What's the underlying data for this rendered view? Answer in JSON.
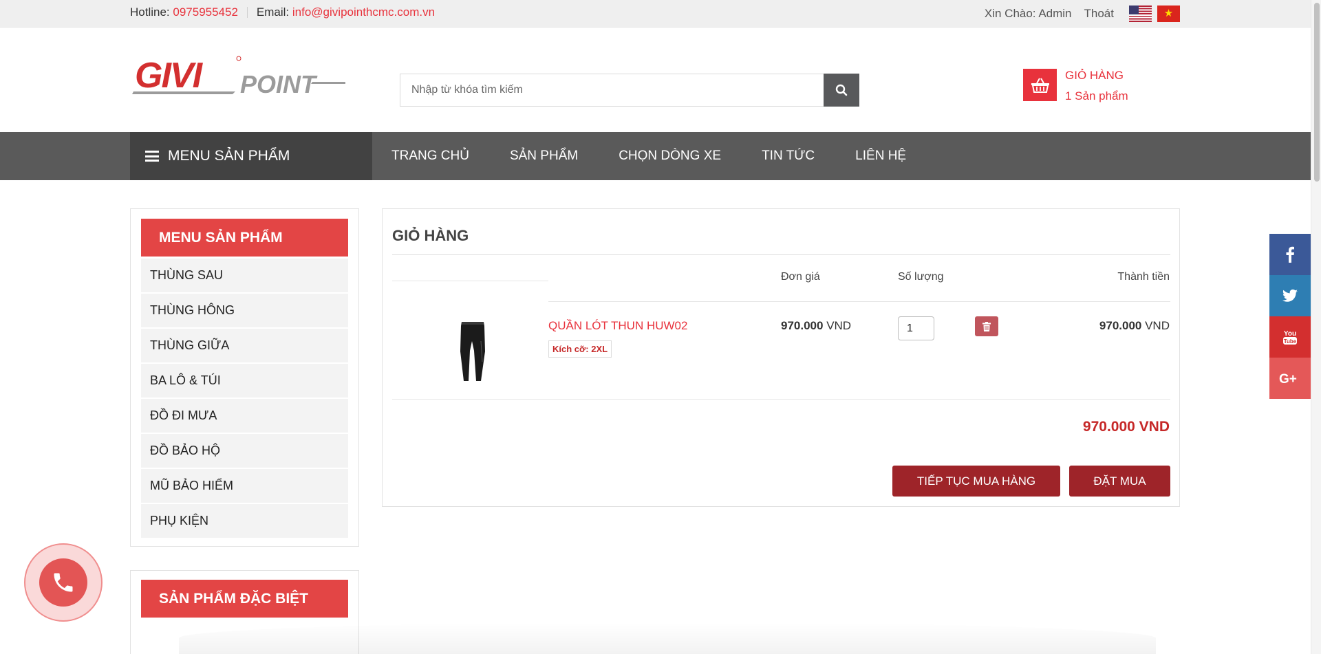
{
  "topbar": {
    "hotline_label": "Hotline:",
    "hotline_number": "0975955452",
    "email_label": "Email:",
    "email_address": "info@givipointhcmc.com.vn",
    "greeting": "Xin Chào: Admin",
    "logout": "Thoát"
  },
  "header": {
    "logo_primary": "GIVI",
    "logo_secondary": "POINT",
    "search_placeholder": "Nhập từ khóa tìm kiếm",
    "cart_title": "GIỎ HÀNG",
    "cart_count": "1 Sản phẩm"
  },
  "nav": {
    "menu_button": "MENU SẢN PHẨM",
    "items": [
      "TRANG CHỦ",
      "SẢN PHẨM",
      "CHỌN DÒNG XE",
      "TIN TỨC",
      "LIÊN HỆ"
    ]
  },
  "sidebar": {
    "title": "MENU SẢN PHẨM",
    "items": [
      "THÙNG SAU",
      "THÙNG HÔNG",
      "THÙNG GIỮA",
      "BA LÔ & TÚI",
      "ĐỒ ĐI MƯA",
      "ĐỒ BẢO HỘ",
      "MŨ BẢO HIỂM",
      "PHỤ KIỆN"
    ],
    "special_title": "SẢN PHẨM ĐẶC BIỆT"
  },
  "cart": {
    "title": "GIỎ HÀNG",
    "headers": {
      "price": "Đơn giá",
      "qty": "Số lượng",
      "total": "Thành tiền"
    },
    "item": {
      "name": "QUẦN LÓT THUN HUW02",
      "size_label": "Kích cỡ:",
      "size_value": "2XL",
      "price_amount": "970.000",
      "currency": "VND",
      "quantity": "1",
      "total_amount": "970.000"
    },
    "grand_total": "970.000 VND",
    "continue_button": "TIẾP TỤC MUA HÀNG",
    "order_button": "ĐẶT MUA"
  },
  "social": [
    "facebook-icon",
    "twitter-icon",
    "youtube-icon",
    "google-plus-icon"
  ],
  "colors": {
    "brand_red": "#e8323c",
    "dark_red": "#9e2429",
    "nav_gray": "#5a5a5a",
    "menu_dark": "#424242"
  }
}
